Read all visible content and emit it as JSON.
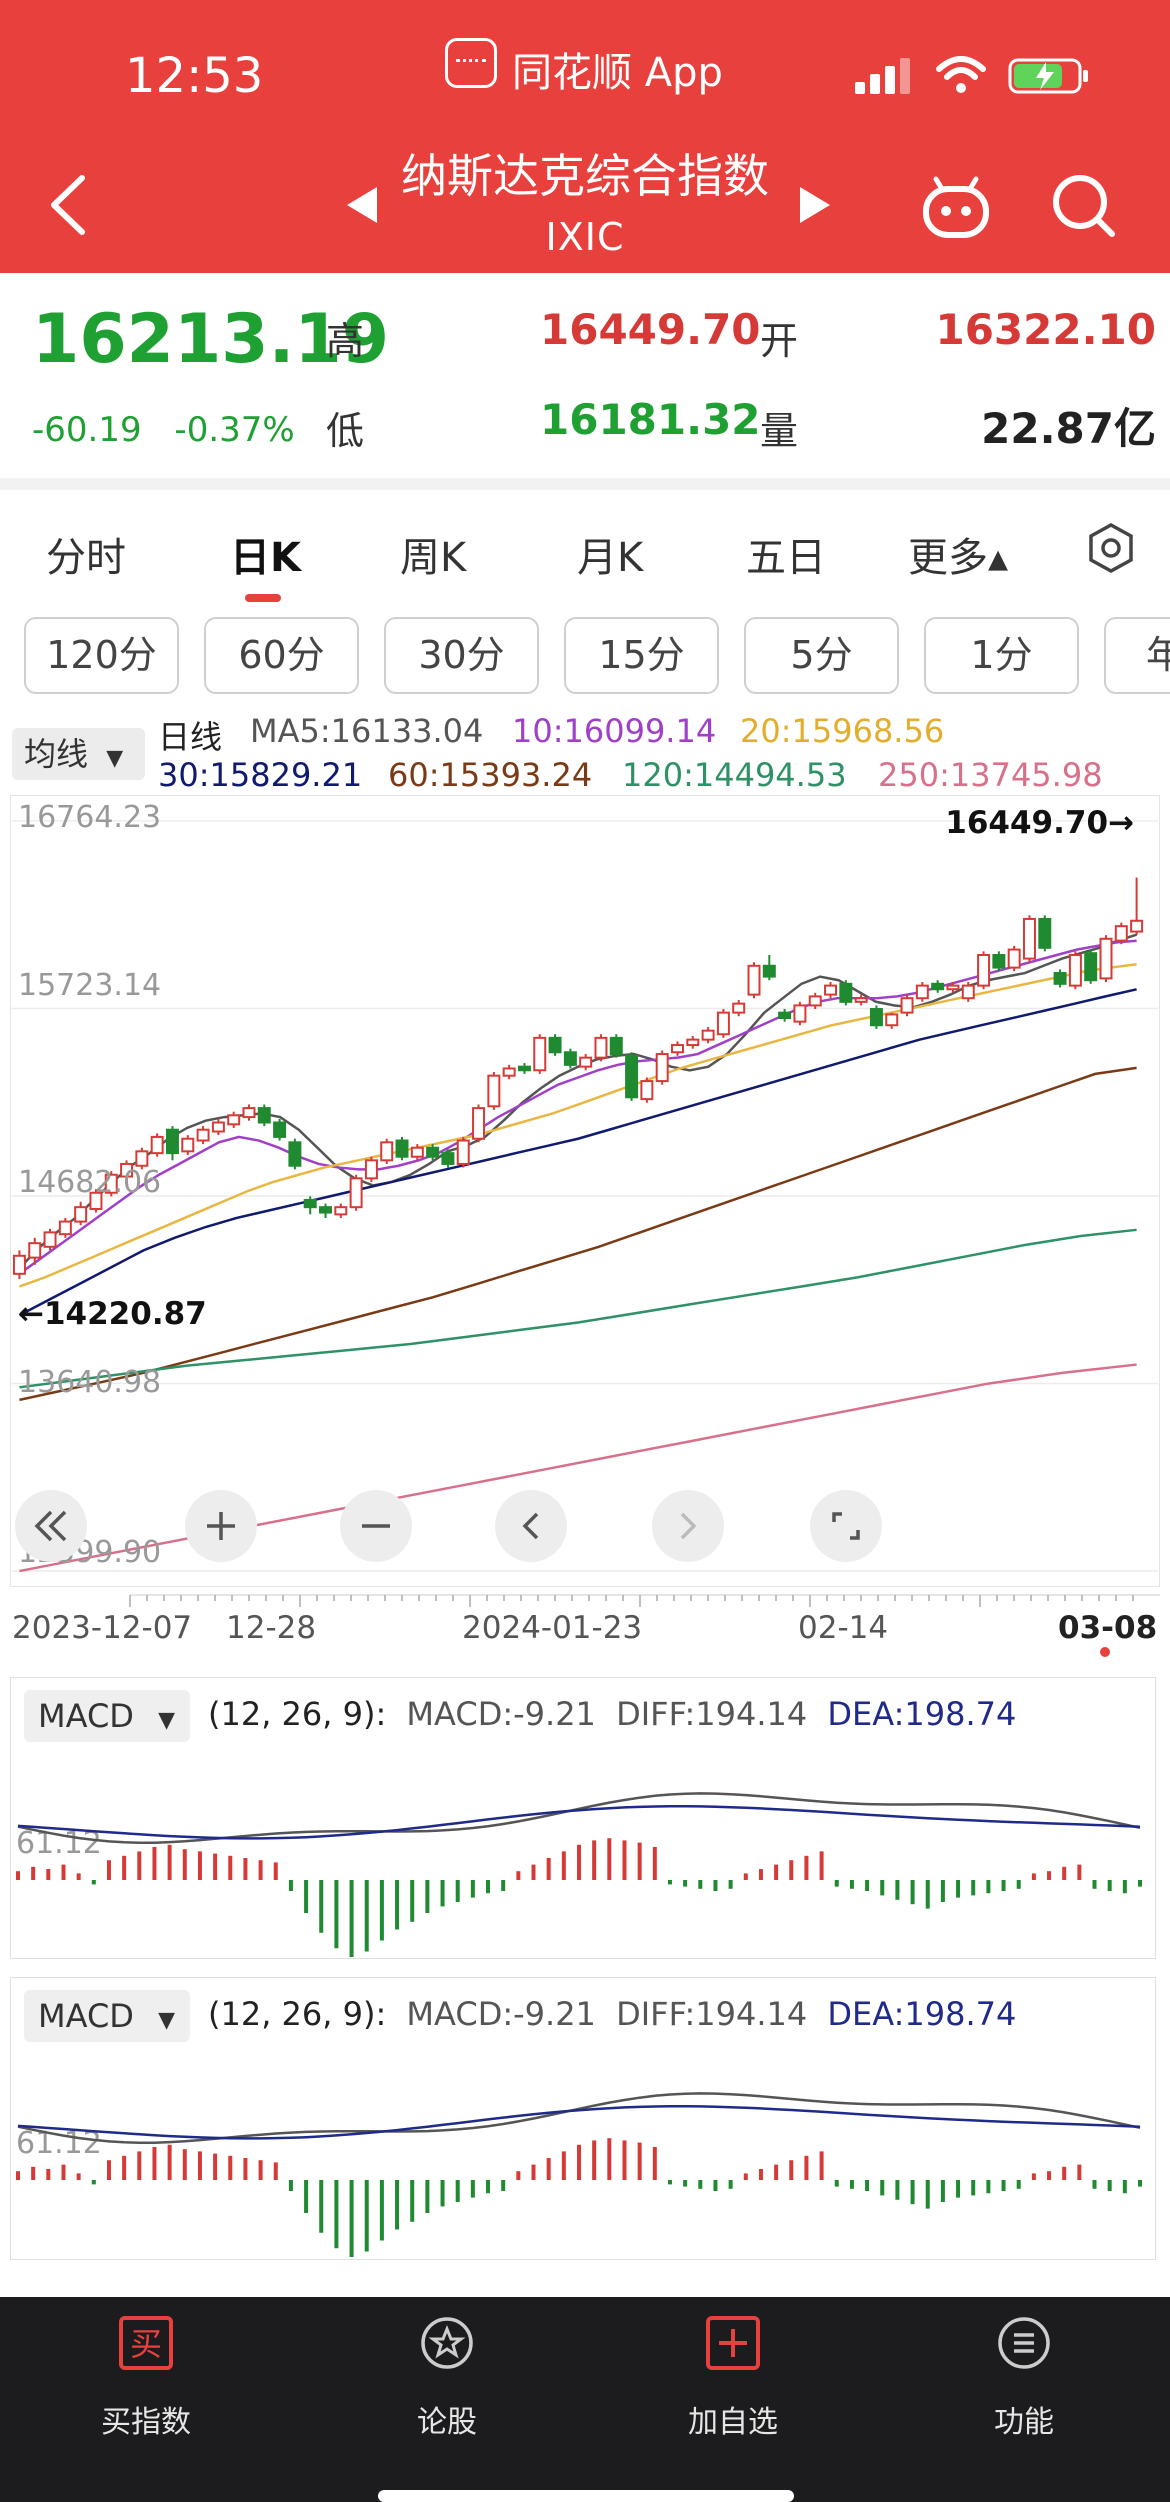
{
  "status_bar": {
    "time": "12:53",
    "app_name": "同花顺 App"
  },
  "header": {
    "index_name": "纳斯达克综合指数",
    "index_code": "IXIC"
  },
  "quote": {
    "price": "16213.19",
    "change": "-60.19",
    "change_pct": "-0.37%",
    "high_label": "高",
    "high": "16449.70",
    "low_label": "低",
    "low": "16181.32",
    "open_label": "开",
    "open": "16322.10",
    "volume_label": "量",
    "volume": "22.87亿"
  },
  "period_tabs": [
    "分时",
    "日K",
    "周K",
    "月K",
    "五日",
    "更多▴"
  ],
  "active_tab": "日K",
  "minute_buttons": [
    "120分",
    "60分",
    "30分",
    "15分",
    "5分",
    "1分",
    "年"
  ],
  "ma_legend": {
    "selector": "均线",
    "line_label": "日线",
    "ma5": "MA5:16133.04",
    "ma10": "10:16099.14",
    "ma20": "20:15968.56",
    "ma30": "30:15829.21",
    "ma60": "60:15393.24",
    "ma120": "120:14494.53",
    "ma250": "250:13745.98"
  },
  "chart_data": {
    "type": "candlestick",
    "y_ticks": [
      "16764.23",
      "15723.14",
      "14682.06",
      "13640.98",
      "12599.90"
    ],
    "ylim": [
      12599.9,
      16764.23
    ],
    "x_ticks": [
      "2023-12-07",
      "12-28",
      "2024-01-23",
      "02-14",
      "03-08"
    ],
    "max_annotation": "16449.70→",
    "min_annotation": "←14220.87",
    "candles": [
      [
        14250,
        14350,
        14220.87,
        14380
      ],
      [
        14340,
        14420,
        14300,
        14450
      ],
      [
        14400,
        14480,
        14380,
        14500
      ],
      [
        14470,
        14540,
        14450,
        14560
      ],
      [
        14540,
        14620,
        14520,
        14650
      ],
      [
        14610,
        14700,
        14590,
        14720
      ],
      [
        14700,
        14800,
        14680,
        14820
      ],
      [
        14790,
        14860,
        14760,
        14880
      ],
      [
        14850,
        14930,
        14830,
        14950
      ],
      [
        14920,
        15010,
        14900,
        15030
      ],
      [
        15050,
        14920,
        14880,
        15070
      ],
      [
        14930,
        15000,
        14910,
        15020
      ],
      [
        14990,
        15050,
        14970,
        15070
      ],
      [
        15040,
        15090,
        15020,
        15110
      ],
      [
        15080,
        15130,
        15060,
        15150
      ],
      [
        15120,
        15170,
        15100,
        15190
      ],
      [
        15170,
        15090,
        15070,
        15190
      ],
      [
        15090,
        15010,
        14990,
        15110
      ],
      [
        14980,
        14850,
        14830,
        15000
      ],
      [
        14660,
        14620,
        14580,
        14680
      ],
      [
        14620,
        14590,
        14560,
        14640
      ],
      [
        14580,
        14620,
        14560,
        14640
      ],
      [
        14620,
        14780,
        14600,
        14800
      ],
      [
        14780,
        14880,
        14760,
        14900
      ],
      [
        14880,
        14980,
        14860,
        15000
      ],
      [
        14990,
        14900,
        14880,
        15010
      ],
      [
        14900,
        14950,
        14880,
        14970
      ],
      [
        14950,
        14900,
        14880,
        14970
      ],
      [
        14920,
        14860,
        14840,
        14940
      ],
      [
        14860,
        14990,
        14840,
        15010
      ],
      [
        15000,
        15170,
        14980,
        15190
      ],
      [
        15180,
        15350,
        15160,
        15370
      ],
      [
        15350,
        15390,
        15330,
        15410
      ],
      [
        15400,
        15380,
        15360,
        15420
      ],
      [
        15380,
        15560,
        15360,
        15580
      ],
      [
        15560,
        15480,
        15460,
        15580
      ],
      [
        15480,
        15410,
        15390,
        15500
      ],
      [
        15400,
        15450,
        15380,
        15470
      ],
      [
        15450,
        15560,
        15430,
        15580
      ],
      [
        15560,
        15470,
        15450,
        15580
      ],
      [
        15460,
        15230,
        15210,
        15480
      ],
      [
        15220,
        15320,
        15200,
        15340
      ],
      [
        15320,
        15470,
        15300,
        15490
      ],
      [
        15480,
        15520,
        15460,
        15540
      ],
      [
        15520,
        15550,
        15500,
        15570
      ],
      [
        15550,
        15600,
        15530,
        15620
      ],
      [
        15580,
        15700,
        15560,
        15720
      ],
      [
        15700,
        15750,
        15680,
        15770
      ],
      [
        15800,
        15960,
        15780,
        15980
      ],
      [
        15960,
        15900,
        15880,
        16020
      ],
      [
        15700,
        15670,
        15650,
        15720
      ],
      [
        15650,
        15740,
        15630,
        15760
      ],
      [
        15740,
        15790,
        15720,
        15810
      ],
      [
        15800,
        15850,
        15780,
        15870
      ],
      [
        15860,
        15760,
        15740,
        15880
      ],
      [
        15760,
        15780,
        15740,
        15800
      ],
      [
        15720,
        15630,
        15610,
        15740
      ],
      [
        15630,
        15690,
        15610,
        15700
      ],
      [
        15700,
        15780,
        15680,
        15800
      ],
      [
        15780,
        15850,
        15760,
        15870
      ],
      [
        15860,
        15830,
        15810,
        15880
      ],
      [
        15830,
        15850,
        15810,
        15870
      ],
      [
        15780,
        15850,
        15760,
        15870
      ],
      [
        15850,
        16020,
        15830,
        16040
      ],
      [
        16020,
        15950,
        15930,
        16040
      ],
      [
        15950,
        16050,
        15930,
        16070
      ],
      [
        16000,
        16220,
        15980,
        16240
      ],
      [
        16220,
        16060,
        16040,
        16240
      ],
      [
        15920,
        15860,
        15840,
        15940
      ],
      [
        15850,
        16020,
        15830,
        16040
      ],
      [
        16030,
        15880,
        15860,
        16050
      ],
      [
        15890,
        16110,
        15870,
        16130
      ],
      [
        16100,
        16180,
        16080,
        16200
      ],
      [
        16150,
        16210,
        16130,
        16449.7
      ]
    ],
    "ma_series": [
      {
        "name": "MA5",
        "color": "#555555",
        "values": [
          14280,
          14390,
          14480,
          14560,
          14660,
          14760,
          14850,
          14920,
          15000,
          15060,
          15100,
          15120,
          15130,
          15140,
          15120,
          15050,
          14950,
          14850,
          14780,
          14740,
          14760,
          14800,
          14860,
          14930,
          14960,
          15010,
          15100,
          15200,
          15280,
          15350,
          15400,
          15440,
          15460,
          15470,
          15440,
          15400,
          15380,
          15400,
          15470,
          15580,
          15700,
          15780,
          15860,
          15900,
          15880,
          15820,
          15760,
          15740,
          15730,
          15760,
          15800,
          15850,
          15880,
          15900,
          15920,
          15960,
          16000,
          16030,
          16060,
          16100,
          16133.04
        ]
      },
      {
        "name": "MA10",
        "color": "#a040c8",
        "values": [
          14250,
          14330,
          14410,
          14490,
          14570,
          14650,
          14730,
          14800,
          14860,
          14920,
          14980,
          15010,
          14990,
          14950,
          14900,
          14860,
          14840,
          14830,
          14830,
          14850,
          14880,
          14920,
          14980,
          15050,
          15120,
          15180,
          15240,
          15300,
          15340,
          15380,
          15410,
          15430,
          15440,
          15450,
          15470,
          15520,
          15570,
          15620,
          15670,
          15720,
          15760,
          15780,
          15780,
          15780,
          15790,
          15810,
          15840,
          15870,
          15900,
          15930,
          15960,
          15990,
          16020,
          16050,
          16070,
          16090,
          16099.14
        ]
      },
      {
        "name": "MA20",
        "color": "#e9b741",
        "values": [
          14180,
          14230,
          14290,
          14350,
          14410,
          14470,
          14530,
          14590,
          14650,
          14710,
          14760,
          14800,
          14840,
          14870,
          14900,
          14930,
          14960,
          14990,
          15020,
          15060,
          15100,
          15140,
          15190,
          15240,
          15290,
          15340,
          15390,
          15430,
          15470,
          15510,
          15550,
          15590,
          15630,
          15660,
          15690,
          15720,
          15750,
          15780,
          15810,
          15840,
          15870,
          15900,
          15930,
          15950,
          15968.56
        ]
      },
      {
        "name": "MA30",
        "color": "#101a6e",
        "values": [
          14020,
          14110,
          14200,
          14290,
          14380,
          14450,
          14510,
          14560,
          14600,
          14640,
          14680,
          14720,
          14760,
          14800,
          14840,
          14880,
          14920,
          14960,
          15000,
          15050,
          15100,
          15150,
          15200,
          15250,
          15300,
          15350,
          15400,
          15450,
          15500,
          15550,
          15590,
          15630,
          15670,
          15710,
          15750,
          15790,
          15829.21
        ]
      },
      {
        "name": "MA60",
        "color": "#7a3a16",
        "values": [
          13550,
          13600,
          13650,
          13700,
          13760,
          13820,
          13880,
          13940,
          14000,
          14060,
          14120,
          14190,
          14260,
          14330,
          14400,
          14480,
          14560,
          14640,
          14720,
          14800,
          14880,
          14960,
          15040,
          15120,
          15200,
          15280,
          15360,
          15393.24
        ]
      },
      {
        "name": "MA120",
        "color": "#2e9266",
        "values": [
          13620,
          13660,
          13700,
          13740,
          13770,
          13800,
          13830,
          13860,
          13900,
          13940,
          13980,
          14030,
          14080,
          14130,
          14180,
          14230,
          14290,
          14350,
          14410,
          14460,
          14494.53
        ]
      },
      {
        "name": "MA250",
        "color": "#d9708a",
        "values": [
          12600,
          12680,
          12760,
          12840,
          12920,
          13000,
          13080,
          13160,
          13240,
          13320,
          13400,
          13480,
          13560,
          13640,
          13700,
          13745.98
        ]
      }
    ]
  },
  "chart_controls": [
    "«",
    "+",
    "−",
    "‹",
    "›",
    "⌜⌟"
  ],
  "macd_panels": [
    {
      "selector": "MACD",
      "params": "(12, 26, 9):",
      "macd": "MACD:-9.21",
      "diff": "DIFF:194.14",
      "dea": "DEA:198.74",
      "ylabel": "61.12"
    },
    {
      "selector": "MACD",
      "params": "(12, 26, 9):",
      "macd": "MACD:-9.21",
      "diff": "DIFF:194.14",
      "dea": "DEA:198.74",
      "ylabel": "61.12"
    }
  ],
  "macd_hist": [
    8,
    12,
    10,
    14,
    6,
    -4,
    18,
    22,
    26,
    30,
    32,
    28,
    26,
    24,
    22,
    20,
    18,
    16,
    -10,
    -30,
    -48,
    -62,
    -70,
    -65,
    -55,
    -45,
    -38,
    -30,
    -24,
    -20,
    -16,
    -12,
    -10,
    8,
    14,
    20,
    26,
    32,
    36,
    38,
    36,
    34,
    30,
    -4,
    -6,
    -8,
    -10,
    -8,
    6,
    10,
    14,
    18,
    22,
    26,
    -6,
    -8,
    -10,
    -14,
    -18,
    -22,
    -26,
    -20,
    -16,
    -14,
    -12,
    -10,
    -8,
    6,
    8,
    12,
    14,
    -8,
    -10,
    -12,
    -6
  ],
  "bottom_nav": [
    {
      "label": "买指数",
      "icon": "buy-icon"
    },
    {
      "label": "论股",
      "icon": "discuss-icon"
    },
    {
      "label": "加自选",
      "icon": "add-watchlist-icon"
    },
    {
      "label": "功能",
      "icon": "menu-icon"
    }
  ],
  "colors": {
    "header": "#e8413d",
    "up": "#d63a36",
    "down": "#1f8a2f",
    "nav_icon": "#e8413d"
  }
}
